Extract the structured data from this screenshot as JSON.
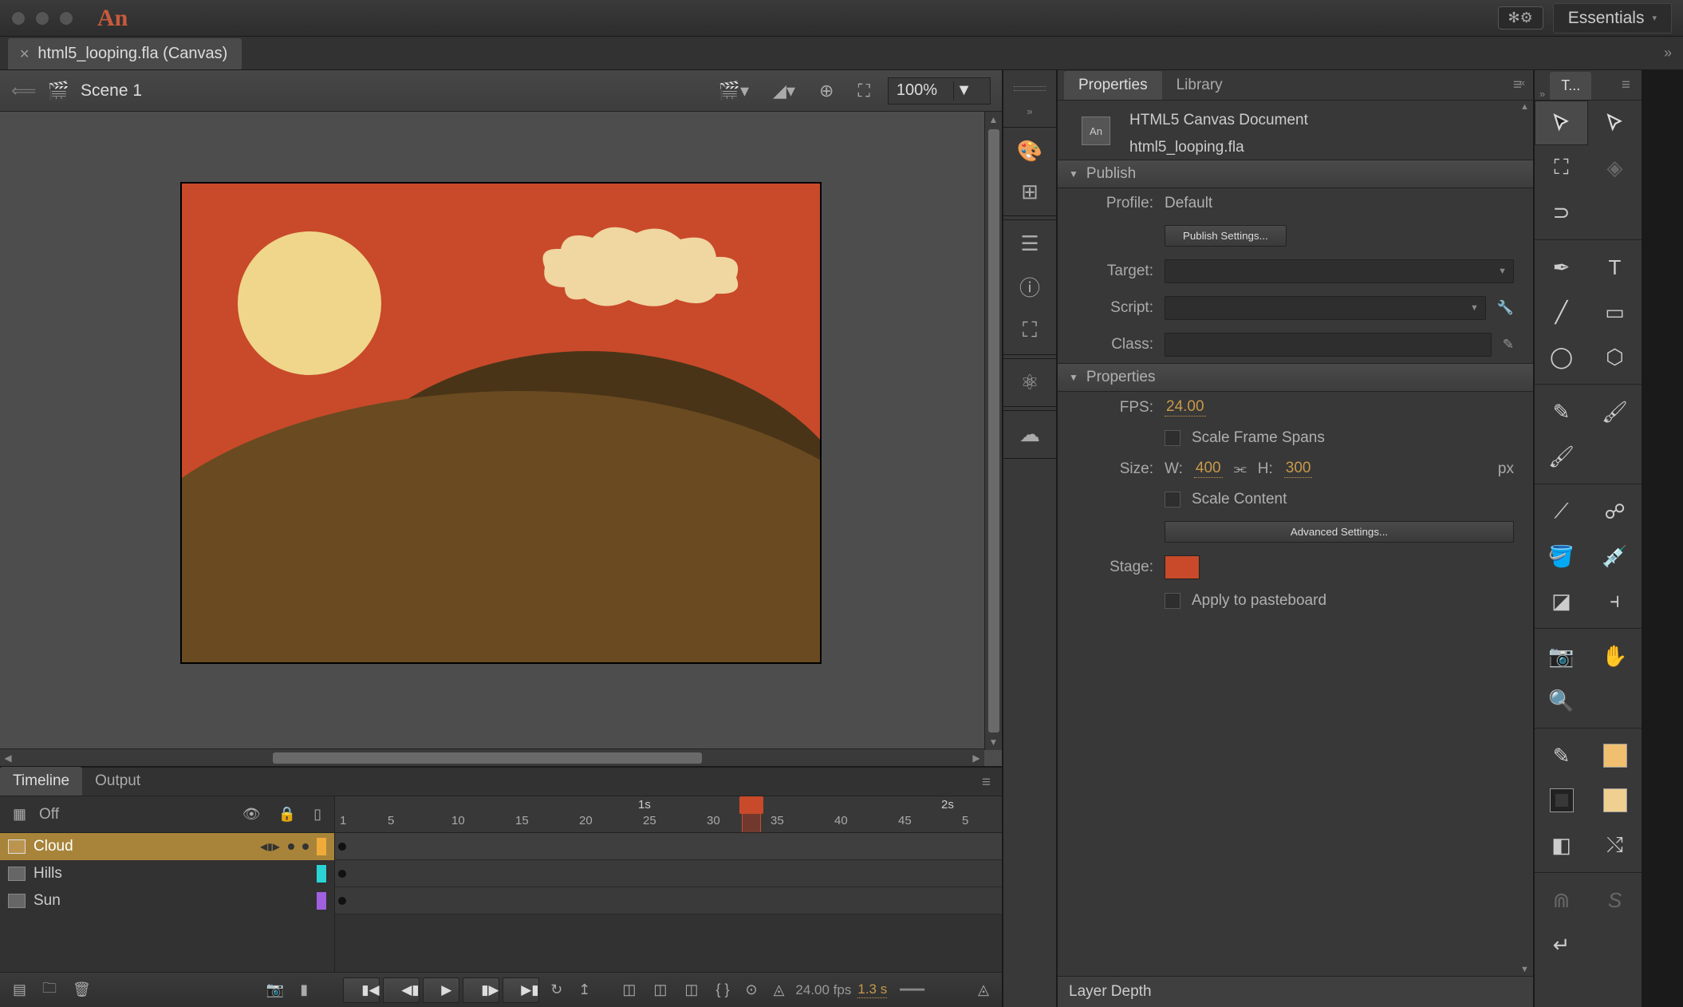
{
  "app": {
    "logo": "An",
    "workspace_label": "Essentials"
  },
  "doctab": {
    "title": "html5_looping.fla (Canvas)"
  },
  "scene": {
    "name": "Scene 1",
    "zoom": "100%"
  },
  "timeline": {
    "tabs": [
      "Timeline",
      "Output"
    ],
    "onion_label": "Off",
    "layers": [
      {
        "name": "Cloud",
        "selected": true,
        "color": "#f0aa3a"
      },
      {
        "name": "Hills",
        "selected": false,
        "color": "#2ad4d4"
      },
      {
        "name": "Sun",
        "selected": false,
        "color": "#a060e0"
      }
    ],
    "ticks": [
      "1",
      "5",
      "10",
      "15",
      "20",
      "25",
      "30",
      "35",
      "40",
      "45",
      "5"
    ],
    "seconds": [
      "1s",
      "2s"
    ],
    "footer": {
      "fps_label": "24.00 fps",
      "time_label": "1.3 s"
    }
  },
  "props": {
    "tabs": [
      "Properties",
      "Library"
    ],
    "doc_type": "HTML5 Canvas Document",
    "doc_name": "html5_looping.fla",
    "publish": {
      "heading": "Publish",
      "profile_label": "Profile:",
      "profile_value": "Default",
      "settings_btn": "Publish Settings...",
      "target_label": "Target:",
      "script_label": "Script:",
      "class_label": "Class:"
    },
    "properties": {
      "heading": "Properties",
      "fps_label": "FPS:",
      "fps_value": "24.00",
      "scale_spans": "Scale Frame Spans",
      "size_label": "Size:",
      "w_label": "W:",
      "w_value": "400",
      "h_label": "H:",
      "h_value": "300",
      "px": "px",
      "scale_content": "Scale Content",
      "adv_btn": "Advanced Settings...",
      "stage_label": "Stage:",
      "apply_pb": "Apply to pasteboard"
    },
    "layer_depth": "Layer Depth"
  },
  "tools": {
    "tab": "T..."
  }
}
